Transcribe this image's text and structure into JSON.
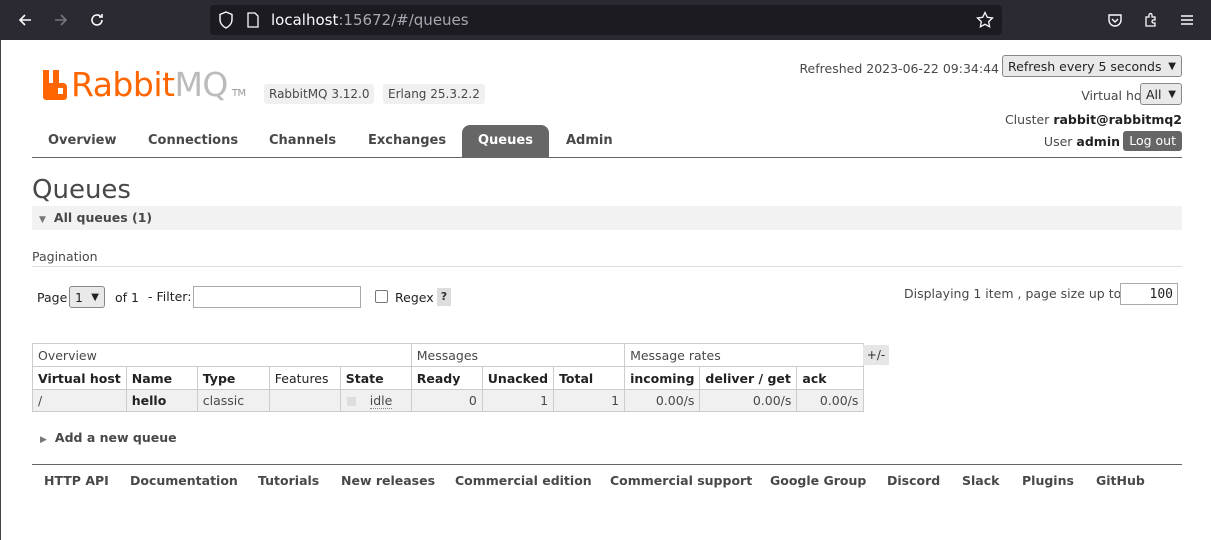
{
  "browser": {
    "url_host": "localhost",
    "url_rest": ":15672/#/queues"
  },
  "header": {
    "brand": "Rabbit",
    "brand_mq": "MQ",
    "tm": "TM",
    "version_badge": "RabbitMQ 3.12.0",
    "erlang_badge": "Erlang 25.3.2.2",
    "refreshed": "Refreshed 2023-06-22 09:34:44",
    "refresh_select": "Refresh every 5 seconds",
    "vhost_label": "Virtual host",
    "vhost_select": "All",
    "cluster_label": "Cluster",
    "cluster_value": "rabbit@rabbitmq2",
    "user_label": "User",
    "user_value": "admin",
    "logout": "Log out"
  },
  "tabs": [
    {
      "label": "Overview"
    },
    {
      "label": "Connections"
    },
    {
      "label": "Channels"
    },
    {
      "label": "Exchanges"
    },
    {
      "label": "Queues"
    },
    {
      "label": "Admin"
    }
  ],
  "page_title": "Queues",
  "all_queues": "All queues (1)",
  "pagination": {
    "label": "Pagination",
    "page": "Page",
    "page_select": "1",
    "of": "of 1",
    "filter": "- Filter:",
    "filter_value": "",
    "regex": "Regex",
    "help": "?",
    "displaying": "Displaying 1 item , page size up to:",
    "page_size": "100"
  },
  "table": {
    "groups": [
      "Overview",
      "Messages",
      "Message rates"
    ],
    "headers": [
      "Virtual host",
      "Name",
      "Type",
      "Features",
      "State",
      "Ready",
      "Unacked",
      "Total",
      "incoming",
      "deliver / get",
      "ack"
    ],
    "rows": [
      {
        "vhost": "/",
        "name": "hello",
        "type": "classic",
        "features": "",
        "state": "idle",
        "ready": "0",
        "unacked": "1",
        "total": "1",
        "incoming": "0.00/s",
        "deliver": "0.00/s",
        "ack": "0.00/s"
      }
    ],
    "toggle": "+/-"
  },
  "add_queue": "Add a new queue",
  "footer": [
    "HTTP API",
    "Documentation",
    "Tutorials",
    "New releases",
    "Commercial edition",
    "Commercial support",
    "Google Group",
    "Discord",
    "Slack",
    "Plugins",
    "GitHub"
  ]
}
